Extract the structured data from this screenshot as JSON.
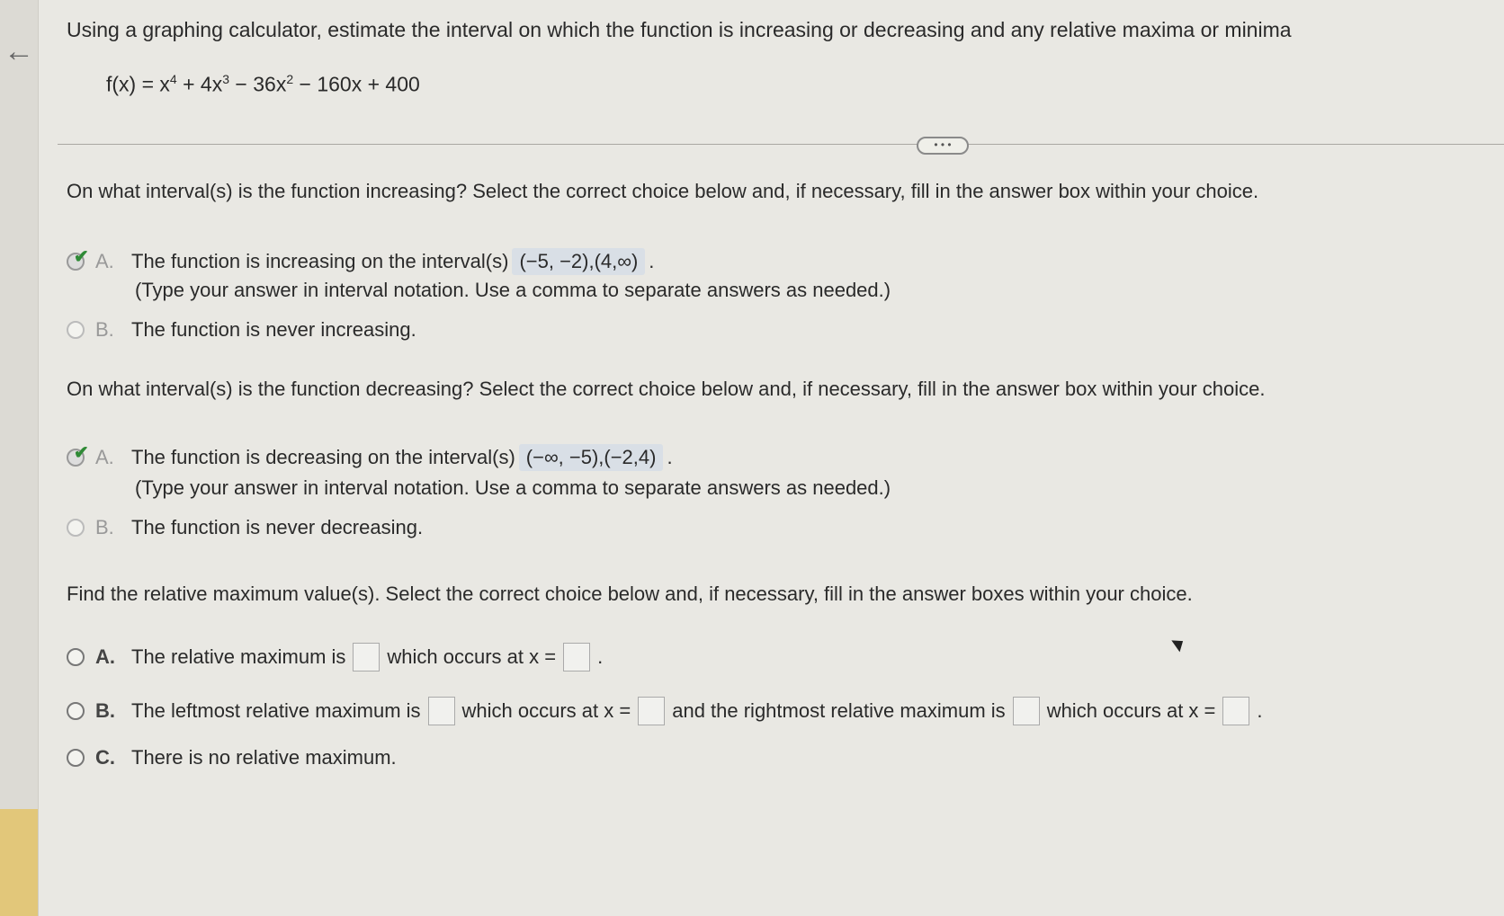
{
  "question": {
    "title": "Using a graphing calculator, estimate the interval on which the function is increasing or decreasing and any relative maxima or minima",
    "formula": {
      "prefix": "f(x) = x",
      "exp1": "4",
      "mid1": " + 4x",
      "exp2": "3",
      "mid2": " − 36x",
      "exp3": "2",
      "tail": " − 160x + 400"
    }
  },
  "more_button": "• • •",
  "increasing": {
    "prompt": "On what interval(s) is the function increasing? Select the correct choice below and, if necessary, fill in the answer box within your choice.",
    "a_letter": "A.",
    "a_text": "The function is increasing on the interval(s)",
    "a_answer": "(−5, −2),(4,∞)",
    "a_end": ".",
    "a_hint": "(Type your answer in interval notation. Use a comma to separate answers as needed.)",
    "b_letter": "B.",
    "b_text": "The function is never increasing."
  },
  "decreasing": {
    "prompt": "On what interval(s) is the function decreasing? Select the correct choice below and, if necessary, fill in the answer box within your choice.",
    "a_letter": "A.",
    "a_text": "The function is decreasing on the interval(s)",
    "a_answer": "(−∞, −5),(−2,4)",
    "a_end": ".",
    "a_hint": "(Type your answer in interval notation. Use a comma to separate answers as needed.)",
    "b_letter": "B.",
    "b_text": "The function is never decreasing."
  },
  "relmax": {
    "prompt": "Find the relative maximum value(s). Select the correct choice below and, if necessary, fill in the answer boxes within your choice.",
    "a_letter": "A.",
    "a_text1": "The relative maximum is",
    "a_text2": "which occurs at x =",
    "a_end": ".",
    "b_letter": "B.",
    "b_text1": "The leftmost relative maximum is",
    "b_text2": "which occurs at x =",
    "b_text3": "and the rightmost relative maximum is",
    "b_text4": "which occurs at x =",
    "b_end": ".",
    "c_letter": "C.",
    "c_text": "There is no relative maximum."
  },
  "icons": {
    "back": "arrow-left-icon",
    "check": "checkmark-icon"
  },
  "colors": {
    "check": "#2f8a36",
    "answer_bg": "#d9dfe6",
    "accent": "#e2c77a"
  }
}
